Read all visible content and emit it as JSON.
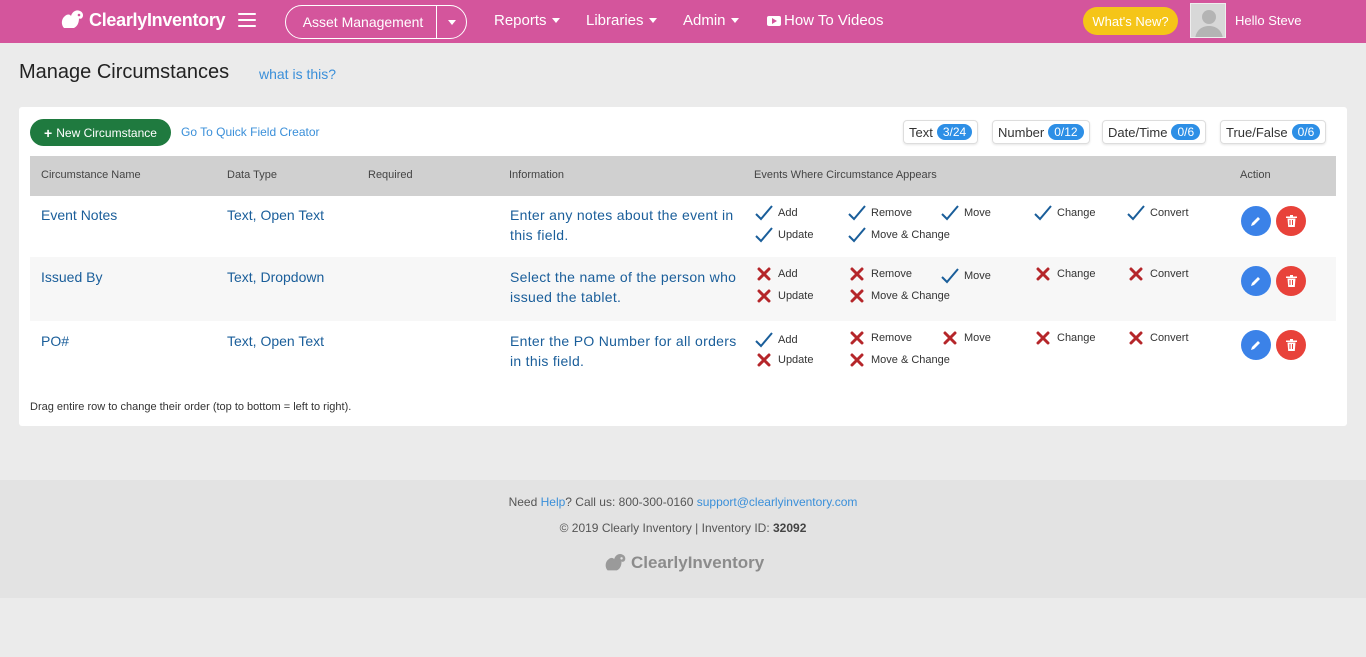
{
  "nav": {
    "brand": "ClearlyInventory",
    "asset_menu": "Asset Management",
    "links": [
      "Reports",
      "Libraries",
      "Admin"
    ],
    "videos": "How To Videos",
    "whats_new": "What's New?",
    "greeting": "Hello Steve",
    "colors": {
      "bar": "#d4559c",
      "whats_new": "#f5c518"
    }
  },
  "header": {
    "title": "Manage Circumstances",
    "help_link": "what is this?"
  },
  "toolbar": {
    "new_button": "New Circumstance",
    "quick_link": "Go To Quick Field Creator",
    "counters": [
      {
        "label": "Text",
        "value": "3/24"
      },
      {
        "label": "Number",
        "value": "0/12"
      },
      {
        "label": "Date/Time",
        "value": "0/6"
      },
      {
        "label": "True/False",
        "value": "0/6"
      }
    ]
  },
  "table": {
    "columns": [
      "Circumstance Name",
      "Data Type",
      "Required",
      "Information",
      "Events Where Circumstance Appears",
      "Action"
    ],
    "rows": [
      {
        "name": "Event Notes",
        "type": "Text, Open Text",
        "required": "",
        "info": "Enter any notes about the event in this field.",
        "events": [
          {
            "label": "Add",
            "on": true
          },
          {
            "label": "Remove",
            "on": true
          },
          {
            "label": "Move",
            "on": true
          },
          {
            "label": "Change",
            "on": true
          },
          {
            "label": "Convert",
            "on": true
          },
          {
            "label": "Update",
            "on": true
          },
          {
            "label": "Move & Change",
            "on": true
          }
        ]
      },
      {
        "name": "Issued By",
        "type": "Text, Dropdown",
        "required": "",
        "info": "Select the name of the person who issued the tablet.",
        "events": [
          {
            "label": "Add",
            "on": false
          },
          {
            "label": "Remove",
            "on": false
          },
          {
            "label": "Move",
            "on": true
          },
          {
            "label": "Change",
            "on": false
          },
          {
            "label": "Convert",
            "on": false
          },
          {
            "label": "Update",
            "on": false
          },
          {
            "label": "Move & Change",
            "on": false
          }
        ]
      },
      {
        "name": "PO#",
        "type": "Text, Open Text",
        "required": "",
        "info": "Enter the PO Number for all orders in this field.",
        "events": [
          {
            "label": "Add",
            "on": true
          },
          {
            "label": "Remove",
            "on": false
          },
          {
            "label": "Move",
            "on": false
          },
          {
            "label": "Change",
            "on": false
          },
          {
            "label": "Convert",
            "on": false
          },
          {
            "label": "Update",
            "on": false
          },
          {
            "label": "Move & Change",
            "on": false
          }
        ]
      }
    ],
    "hint": "Drag entire row to change their order (top to bottom = left to right)."
  },
  "footer": {
    "need": "Need ",
    "help": "Help",
    "call": "? Call us: 800-300-0160 ",
    "email": "support@clearlyinventory.com",
    "copyright": "© 2019 Clearly Inventory | Inventory ID: ",
    "inventory_id": "32092",
    "logo": "ClearlyInventory"
  }
}
